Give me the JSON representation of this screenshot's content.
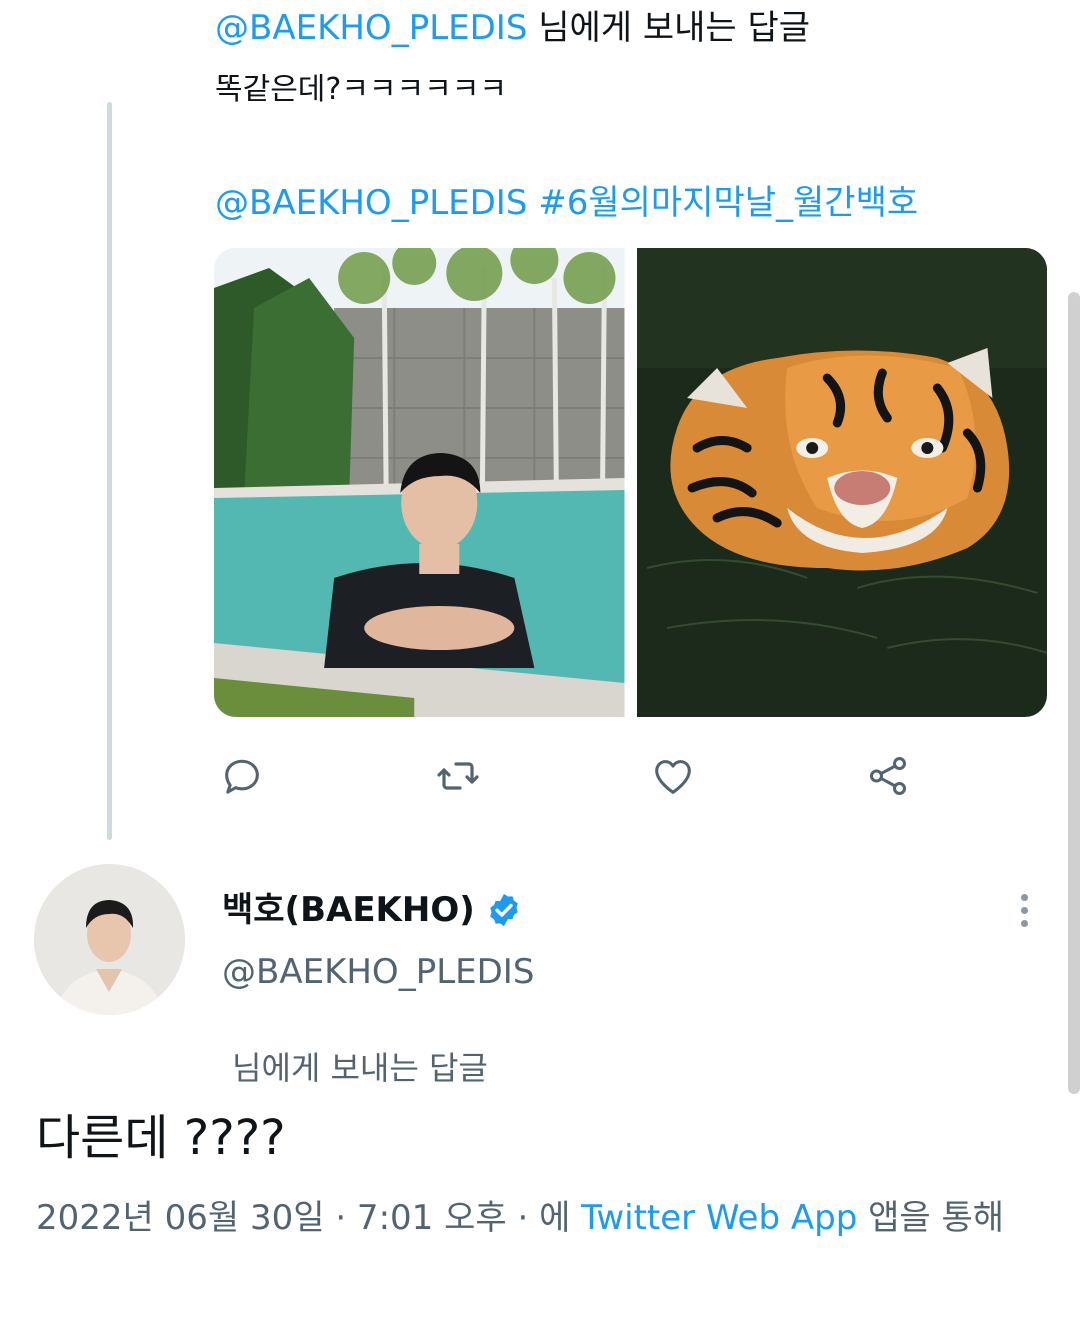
{
  "reply": {
    "mention": "@BAEKHO_PLEDIS",
    "replying_suffix": " 님에게 보내는 답글",
    "text": "똑같은데?ㅋㅋㅋㅋㅋㅋ",
    "quote_mention": "@BAEKHO_PLEDIS",
    "quote_hashtag": " #6월의마지막날_월간백호",
    "media": [
      {
        "icon": "person-in-pool-photo"
      },
      {
        "icon": "tiger-swimming-photo"
      }
    ],
    "actions": [
      {
        "icon": "reply-icon"
      },
      {
        "icon": "retweet-icon"
      },
      {
        "icon": "like-icon"
      },
      {
        "icon": "share-icon"
      }
    ]
  },
  "tweet": {
    "display_name": "백호(BAEKHO)",
    "handle": "@BAEKHO_PLEDIS",
    "verified_icon": "verified-badge-icon",
    "more_icon": "more-options-icon",
    "replying_to": "님에게 보내는 답글",
    "text": "다른데 ????",
    "timestamp": "2022년 06월 30일 · 7:01 오후 · 에 ",
    "source": "Twitter Web App",
    "source_suffix": " 앱을 통해"
  },
  "colors": {
    "accent": "#1d9bf0",
    "text": "#0f1419",
    "secondary": "#536471",
    "thread_line": "#cfd9de"
  }
}
